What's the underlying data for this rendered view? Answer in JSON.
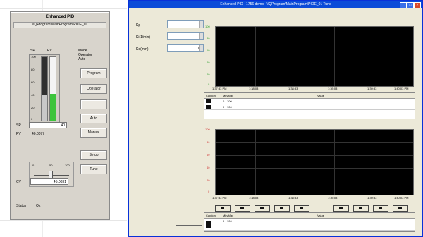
{
  "faceplate": {
    "title": "Enhanced PID",
    "path": "\\\\QProgram\\MainProgram\\PIDE_01",
    "sp_label": "SP",
    "pv_label": "PV",
    "scale": [
      "100",
      "80",
      "60",
      "40",
      "20",
      "0"
    ],
    "bar_sp_fraction": 0.4,
    "bar_pv_fraction": 0.42,
    "mode_lines": [
      "Mode",
      "Operator",
      "Auto"
    ],
    "buttons": [
      "Program",
      "Operator",
      "",
      "Auto",
      "Manual",
      "Setup",
      "Tune"
    ],
    "sp_field_label": "SP",
    "sp_value": "40",
    "pv_field_label": "PV",
    "pv_value": "40.0077",
    "cv_scale": [
      "0",
      "50",
      "100"
    ],
    "cv_fraction": 0.45,
    "cv_field_label": "CV",
    "cv_value": "45.0031",
    "status_label": "Status",
    "status_value": "Ok"
  },
  "window": {
    "title": "Enhanced PID - 1756 demo - \\\\QProgram\\MainProgram\\PIDE_01 Tune",
    "params": [
      {
        "label": "Kp",
        "value": "1"
      },
      {
        "label": "Ki(1/min)",
        "value": "1"
      },
      {
        "label": "Kd(min)",
        "value": "0"
      }
    ],
    "trend1": {
      "y_ticks": [
        "100",
        "80",
        "60",
        "40",
        "20",
        "0"
      ],
      "x_ticks": [
        "1:37:33 PM",
        "1:38:03",
        "1:38:33",
        "1:39:03",
        "1:39:33",
        "1:40:03 PM"
      ],
      "table_headers": [
        "Caption",
        "Min/Max",
        "Value"
      ],
      "table_rows": [
        {
          "min": "0",
          "max": "100",
          "value": ""
        },
        {
          "min": "0",
          "max": "100",
          "value": ""
        }
      ]
    },
    "trend2": {
      "y_ticks": [
        "100",
        "80",
        "60",
        "40",
        "20",
        "0"
      ],
      "x_ticks": [
        "1:37:33 PM",
        "1:38:03",
        "1:38:33",
        "1:39:03",
        "1:39:33",
        "1:40:03 PM"
      ],
      "table_headers": [
        "Caption",
        "Min/Max",
        "Value"
      ],
      "table_rows": [
        {
          "min": "0",
          "max": "100",
          "value": ""
        }
      ]
    },
    "colors": {
      "pen_green": "#2da02d",
      "pen_red": "#d03030",
      "title_blue": "#0b4bd8"
    }
  }
}
